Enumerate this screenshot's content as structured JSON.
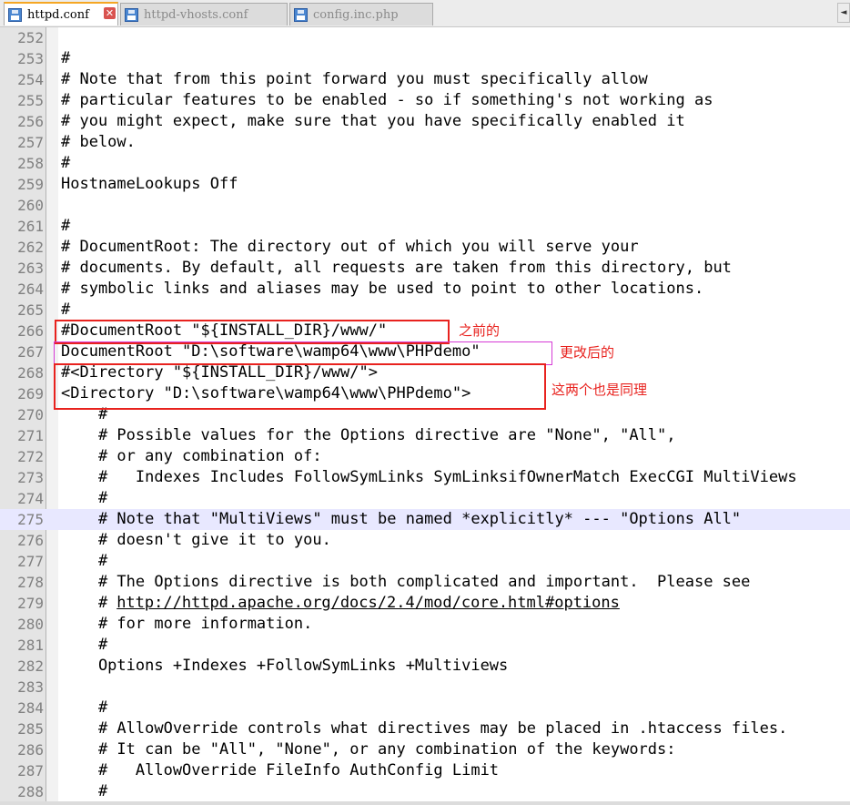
{
  "tabs": [
    {
      "label": "httpd.conf",
      "active": true,
      "close_glyph": "✕"
    },
    {
      "label": "httpd-vhosts.conf",
      "active": false
    },
    {
      "label": "config.inc.php",
      "active": false
    }
  ],
  "tab_scroll_glyph": "◄",
  "current_line": "275",
  "lines": [
    {
      "n": "252",
      "text": ""
    },
    {
      "n": "253",
      "text": "#"
    },
    {
      "n": "254",
      "text": "# Note that from this point forward you must specifically allow"
    },
    {
      "n": "255",
      "text": "# particular features to be enabled - so if something's not working as"
    },
    {
      "n": "256",
      "text": "# you might expect, make sure that you have specifically enabled it"
    },
    {
      "n": "257",
      "text": "# below."
    },
    {
      "n": "258",
      "text": "#"
    },
    {
      "n": "259",
      "text": "HostnameLookups Off"
    },
    {
      "n": "260",
      "text": ""
    },
    {
      "n": "261",
      "text": "#"
    },
    {
      "n": "262",
      "text": "# DocumentRoot: The directory out of which you will serve your"
    },
    {
      "n": "263",
      "text": "# documents. By default, all requests are taken from this directory, but"
    },
    {
      "n": "264",
      "text": "# symbolic links and aliases may be used to point to other locations."
    },
    {
      "n": "265",
      "text": "#"
    },
    {
      "n": "266",
      "text": "#DocumentRoot \"${INSTALL_DIR}/www/\""
    },
    {
      "n": "267",
      "text": "DocumentRoot \"D:\\software\\wamp64\\www\\PHPdemo\""
    },
    {
      "n": "268",
      "text": "#<Directory \"${INSTALL_DIR}/www/\">"
    },
    {
      "n": "269",
      "text": "<Directory \"D:\\software\\wamp64\\www\\PHPdemo\">"
    },
    {
      "n": "270",
      "text": "    #"
    },
    {
      "n": "271",
      "text": "    # Possible values for the Options directive are \"None\", \"All\","
    },
    {
      "n": "272",
      "text": "    # or any combination of:"
    },
    {
      "n": "273",
      "text": "    #   Indexes Includes FollowSymLinks SymLinksifOwnerMatch ExecCGI MultiViews"
    },
    {
      "n": "274",
      "text": "    #"
    },
    {
      "n": "275",
      "text": "    # Note that \"MultiViews\" must be named *explicitly* --- \"Options All\""
    },
    {
      "n": "276",
      "text": "    # doesn't give it to you."
    },
    {
      "n": "277",
      "text": "    #"
    },
    {
      "n": "278",
      "text": "    # The Options directive is both complicated and important.  Please see"
    },
    {
      "n": "279",
      "text": "    # ",
      "link": "http://httpd.apache.org/docs/2.4/mod/core.html#options"
    },
    {
      "n": "280",
      "text": "    # for more information."
    },
    {
      "n": "281",
      "text": "    #"
    },
    {
      "n": "282",
      "text": "    Options +Indexes +FollowSymLinks +Multiviews"
    },
    {
      "n": "283",
      "text": ""
    },
    {
      "n": "284",
      "text": "    #"
    },
    {
      "n": "285",
      "text": "    # AllowOverride controls what directives may be placed in .htaccess files."
    },
    {
      "n": "286",
      "text": "    # It can be \"All\", \"None\", or any combination of the keywords:"
    },
    {
      "n": "287",
      "text": "    #   AllowOverride FileInfo AuthConfig Limit"
    },
    {
      "n": "288",
      "text": "    #"
    }
  ],
  "annotations": {
    "before": "之前的",
    "after": "更改后的",
    "same": "这两个也是同理"
  },
  "colors": {
    "annotation_red": "#e8221e",
    "box_before": "#e8221e",
    "box_after": "#d63bd6",
    "box_directory": "#e8221e",
    "current_line_bg": "#e8e8ff",
    "active_tab_accent": "#f5a623"
  }
}
